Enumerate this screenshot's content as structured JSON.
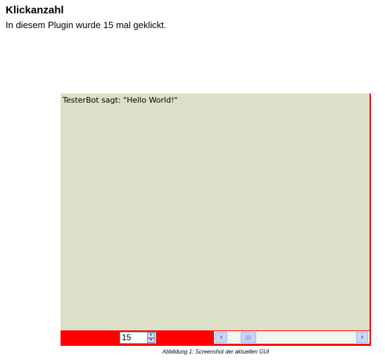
{
  "heading": "Klickanzahl",
  "intro": "In diesem Plugin wurde 15 mal geklickt.",
  "gui": {
    "message": "TesterBot sagt: \"Hello World!\"",
    "spinner": {
      "value": "15",
      "up_icon": "triangle-up-icon",
      "down_icon": "triangle-down-icon"
    },
    "scrollbar": {
      "left_arrow": "‹",
      "right_arrow": "›",
      "thumb_position": 0.12
    },
    "colors": {
      "panel_background": "#dce0c8",
      "bar_background": "#ff0000",
      "border": "#ff0000"
    }
  },
  "caption": "Abbildung 1: Screenshot der aktuellen GUI"
}
